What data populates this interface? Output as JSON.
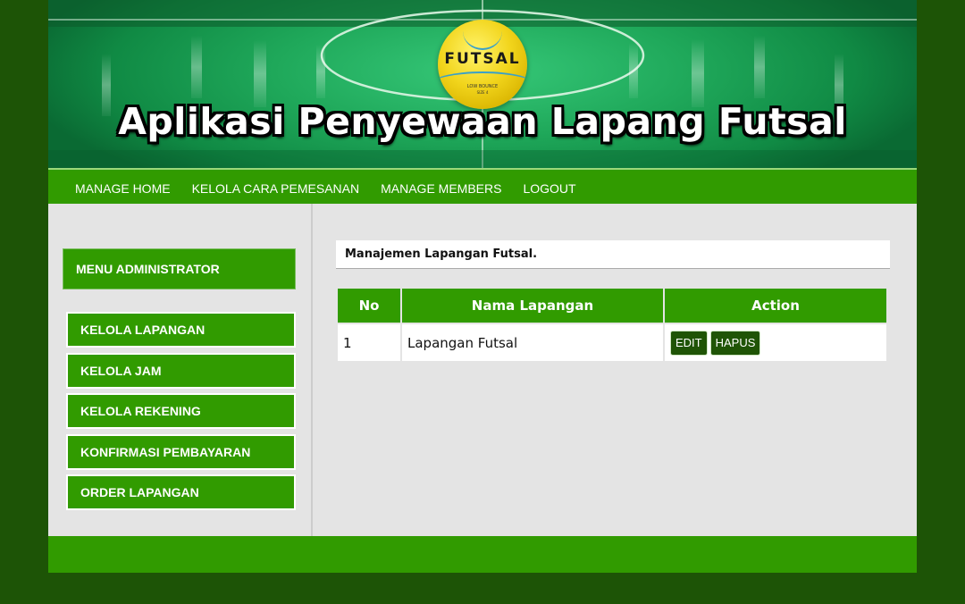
{
  "header": {
    "title": "Aplikasi Penyewaan Lapang Futsal",
    "ball_brand": "FUTSAL",
    "ball_small_1": "LOW BOUNCE",
    "ball_small_2": "SIZE 4"
  },
  "nav": {
    "items": [
      {
        "label": "MANAGE HOME"
      },
      {
        "label": "KELOLA CARA PEMESANAN"
      },
      {
        "label": "MANAGE MEMBERS"
      },
      {
        "label": "LOGOUT"
      }
    ]
  },
  "sidebar": {
    "header": "MENU ADMINISTRATOR",
    "items": [
      {
        "label": "KELOLA LAPANGAN"
      },
      {
        "label": "KELOLA JAM"
      },
      {
        "label": "KELOLA REKENING"
      },
      {
        "label": "KONFIRMASI PEMBAYARAN"
      },
      {
        "label": "ORDER LAPANGAN"
      }
    ]
  },
  "main": {
    "title": "Manajemen Lapangan Futsal.",
    "table": {
      "columns": [
        "No",
        "Nama Lapangan",
        "Action"
      ],
      "rows": [
        {
          "no": "1",
          "name": "Lapangan Futsal",
          "edit_label": "EDIT",
          "delete_label": "HAPUS"
        }
      ]
    }
  },
  "colors": {
    "primary_green": "#319b00",
    "dark_green": "#1d5406",
    "content_bg": "#e4e4e4"
  }
}
